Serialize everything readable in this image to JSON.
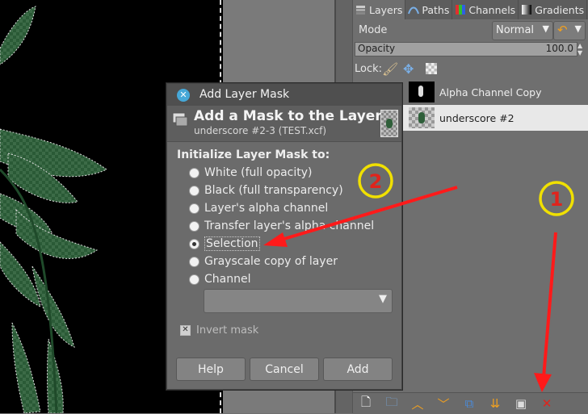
{
  "dock": {
    "tabs": [
      {
        "label": "Layers",
        "icon": "layers-icon"
      },
      {
        "label": "Paths",
        "icon": "paths-icon"
      },
      {
        "label": "Channels",
        "icon": "channels-icon"
      },
      {
        "label": "Gradients",
        "icon": "gradients-icon"
      }
    ],
    "mode_label": "Mode",
    "mode_value": "Normal",
    "opacity_label": "Opacity",
    "opacity_value": "100.0",
    "lock_label": "Lock:",
    "layers": [
      {
        "name": "Alpha Channel Copy",
        "selected": false
      },
      {
        "name": "underscore #2",
        "selected": true
      }
    ],
    "bottom_icons": [
      "new-layer-icon",
      "new-layer-group-icon",
      "raise-layer-icon",
      "lower-layer-icon",
      "duplicate-layer-icon",
      "merge-down-icon",
      "add-mask-icon",
      "delete-layer-icon"
    ]
  },
  "dialog": {
    "title": "Add Layer Mask",
    "heading": "Add a Mask to the Layer",
    "subheading": "underscore #2-3 (TEST.xcf)",
    "section_label": "Initialize Layer Mask to:",
    "options": [
      {
        "label": "White (full opacity)",
        "selected": false
      },
      {
        "label": "Black (full transparency)",
        "selected": false
      },
      {
        "label": "Layer's alpha channel",
        "selected": false
      },
      {
        "label": "Transfer layer's alpha channel",
        "selected": false
      },
      {
        "label": "Selection",
        "selected": true
      },
      {
        "label": "Grayscale copy of layer",
        "selected": false
      },
      {
        "label": "Channel",
        "selected": false
      }
    ],
    "channel_value": "",
    "invert_label": "Invert mask",
    "invert_checked": true,
    "buttons": {
      "help": "Help",
      "cancel": "Cancel",
      "add": "Add"
    }
  },
  "annotations": {
    "marker1": "1",
    "marker2": "2",
    "marker_color": "#f0e000",
    "arrow_color": "#ff1a1a"
  },
  "colors": {
    "close_button": "#46a8d8",
    "leaf_green": "#1f4a2a",
    "delete_icon": "#e0241c"
  }
}
